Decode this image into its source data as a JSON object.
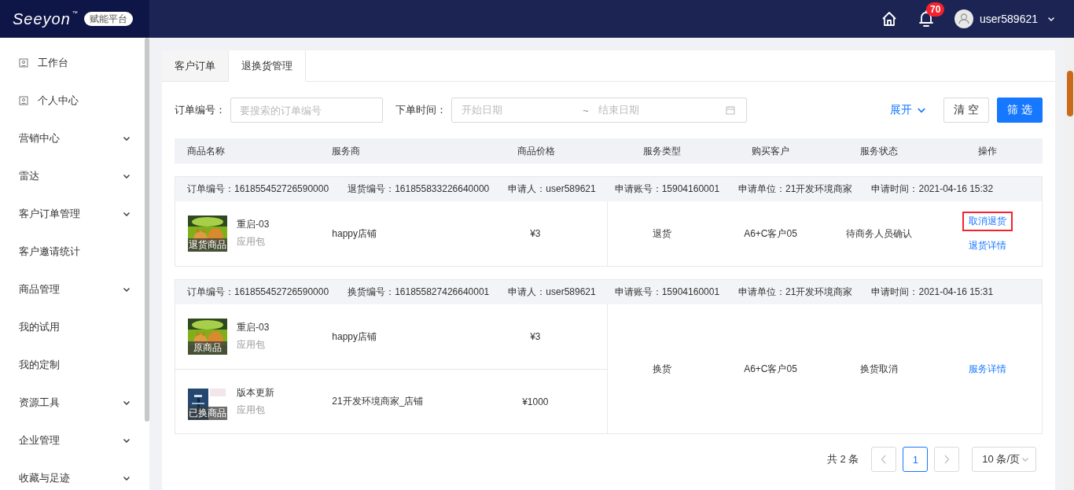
{
  "header": {
    "logo": "Seeyon",
    "logo_mark": "™",
    "platform_badge": "赋能平台",
    "notification_count": "70",
    "username": "user589621"
  },
  "sidebar": {
    "items": [
      {
        "label": "工作台",
        "kind": "link"
      },
      {
        "label": "个人中心",
        "kind": "link"
      },
      {
        "label": "营销中心",
        "kind": "group",
        "expanded": false
      },
      {
        "label": "雷达",
        "kind": "group",
        "expanded": false
      },
      {
        "label": "客户订单管理",
        "kind": "group",
        "expanded": false
      },
      {
        "label": "客户邀请统计",
        "kind": "plain"
      },
      {
        "label": "商品管理",
        "kind": "group",
        "expanded": false
      },
      {
        "label": "我的试用",
        "kind": "plain"
      },
      {
        "label": "我的定制",
        "kind": "plain"
      },
      {
        "label": "资源工具",
        "kind": "group",
        "expanded": false
      },
      {
        "label": "企业管理",
        "kind": "group",
        "expanded": false
      },
      {
        "label": "收藏与足迹",
        "kind": "group",
        "expanded": false
      }
    ]
  },
  "tabs": [
    {
      "label": "客户订单",
      "selected": false
    },
    {
      "label": "退换货管理",
      "selected": true
    }
  ],
  "filters": {
    "order_no": {
      "label": "订单编号：",
      "placeholder": "要搜索的订单编号"
    },
    "order_time": {
      "label": "下单时间：",
      "start_placeholder": "开始日期",
      "separator": "~",
      "end_placeholder": "结束日期"
    },
    "expand_link": "展开",
    "clear_button": "清 空",
    "filter_button": "筛 选"
  },
  "table": {
    "columns": [
      "商品名称",
      "服务商",
      "商品价格",
      "服务类型",
      "购买客户",
      "服务状态",
      "操作"
    ],
    "groups": [
      {
        "info": [
          {
            "label": "订单编号：",
            "value": "161855452726590000"
          },
          {
            "label": "退货编号：",
            "value": "161855833226640000"
          },
          {
            "label": "申请人：",
            "value": "user589621"
          },
          {
            "label": "申请账号：",
            "value": "15904160001"
          },
          {
            "label": "申请单位：",
            "value": "21开发环境商家"
          },
          {
            "label": "申请时间：",
            "value": "2021-04-16 15:32"
          }
        ],
        "items": [
          {
            "tag": "退货商品",
            "name": "重启-03",
            "type": "应用包",
            "provider": "happy店铺",
            "price": "¥3",
            "kind": "cat"
          }
        ],
        "service_type": "退货",
        "customer": "A6+C客户05",
        "status": "待商务人员确认",
        "actions": [
          {
            "label": "取消退货",
            "highlighted": true
          },
          {
            "label": "退货详情",
            "highlighted": false
          }
        ]
      },
      {
        "info": [
          {
            "label": "订单编号：",
            "value": "161855452726590000"
          },
          {
            "label": "换货编号：",
            "value": "161855827426640001"
          },
          {
            "label": "申请人：",
            "value": "user589621"
          },
          {
            "label": "申请账号：",
            "value": "15904160001"
          },
          {
            "label": "申请单位：",
            "value": "21开发环境商家"
          },
          {
            "label": "申请时间：",
            "value": "2021-04-16 15:31"
          }
        ],
        "items": [
          {
            "tag": "原商品",
            "name": "重启-03",
            "type": "应用包",
            "provider": "happy店铺",
            "price": "¥3",
            "kind": "cat"
          },
          {
            "tag": "已换商品",
            "name": "版本更新",
            "type": "应用包",
            "provider": "21开发环境商家_店铺",
            "price": "¥1000",
            "kind": "screen"
          }
        ],
        "service_type": "换货",
        "customer": "A6+C客户05",
        "status": "换货取消",
        "actions": [
          {
            "label": "服务详情",
            "highlighted": false
          }
        ]
      }
    ]
  },
  "pagination": {
    "total": "共 2 条",
    "pages": [
      {
        "label": "1",
        "selected": true
      }
    ],
    "page_size": "10 条/页"
  }
}
